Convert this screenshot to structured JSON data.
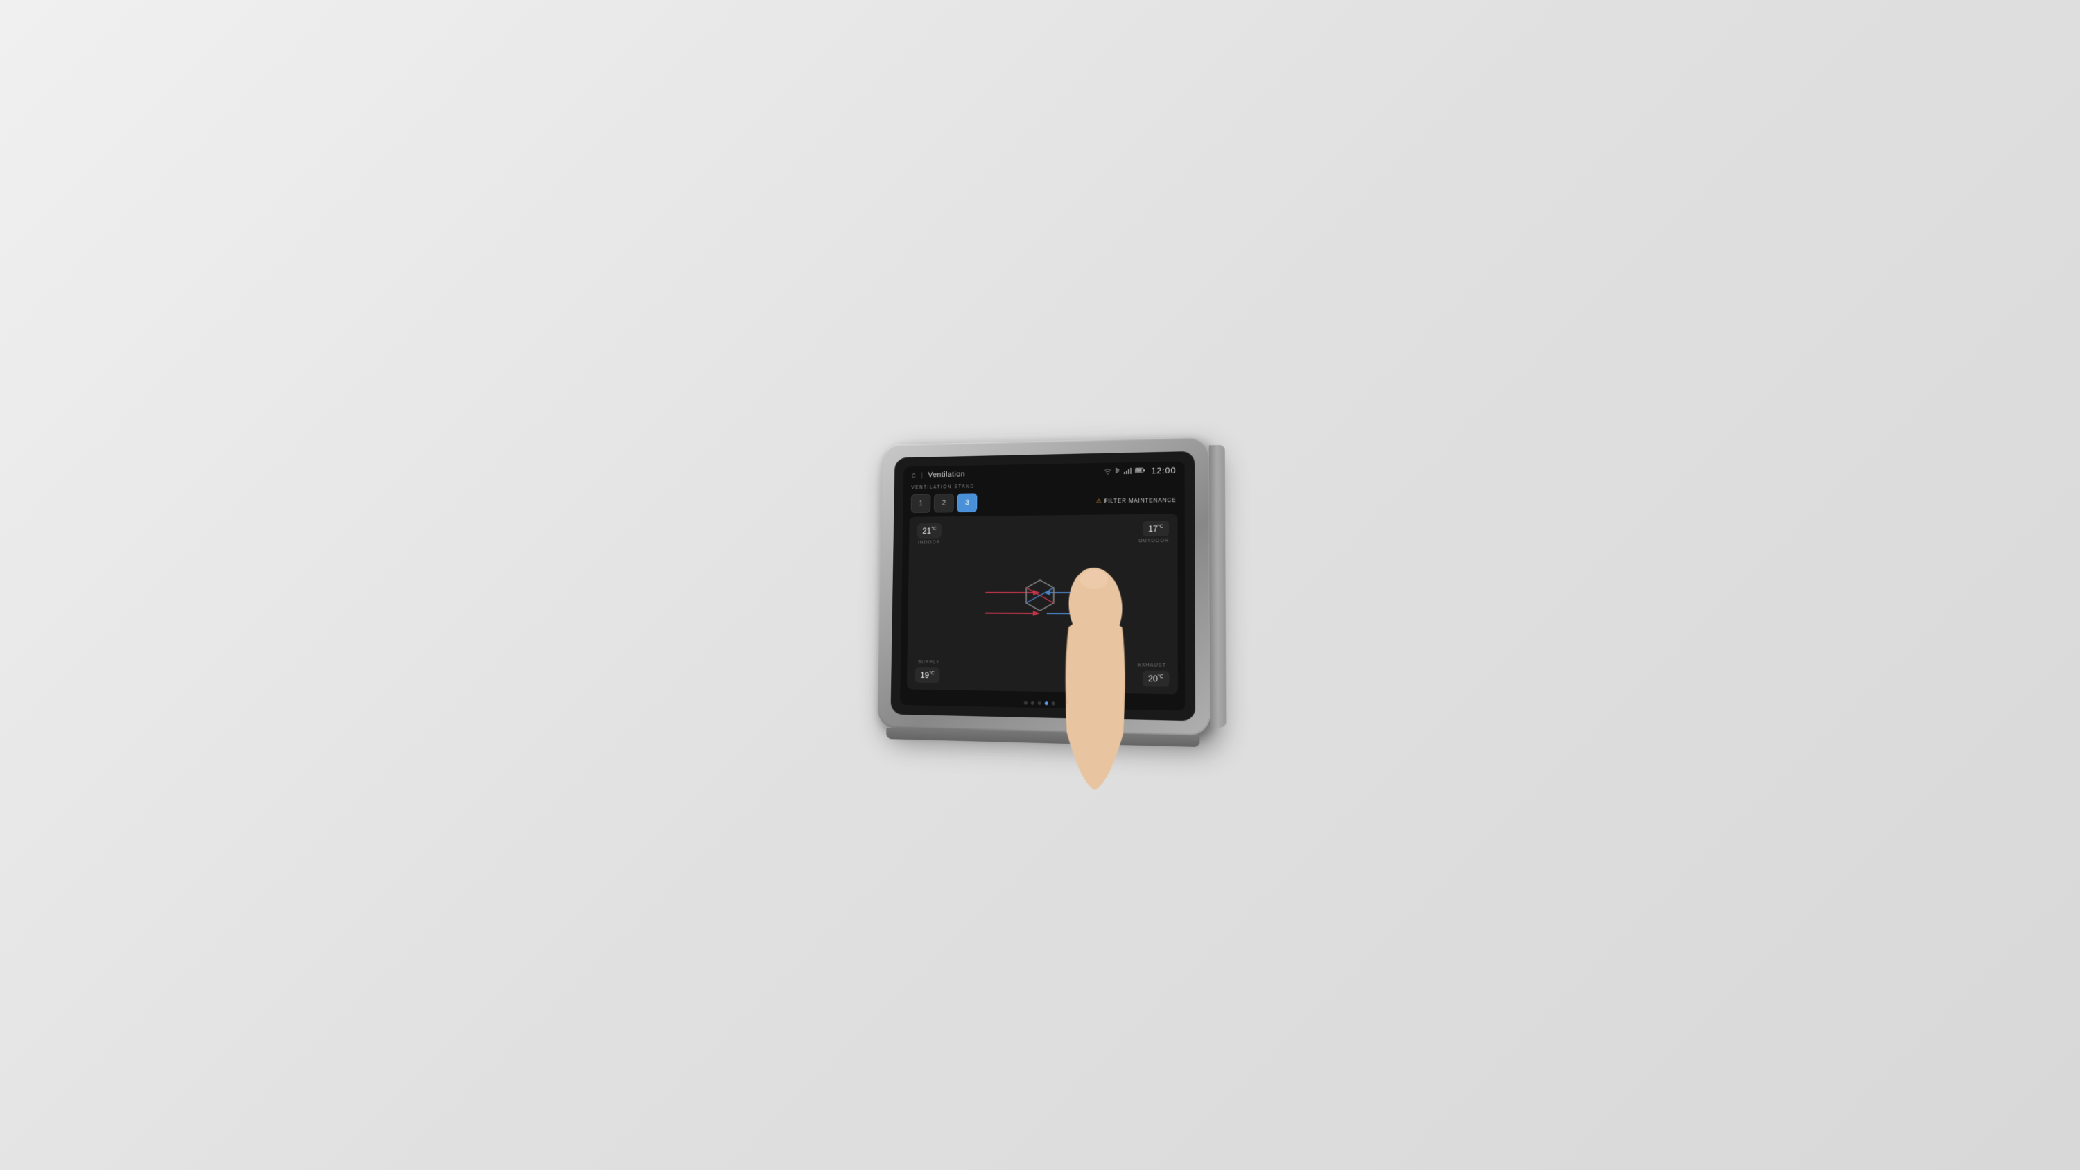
{
  "wall": {
    "background": "#e0e0e0"
  },
  "device": {
    "screen": {
      "status_bar": {
        "home_icon": "⌂",
        "separator": "|",
        "page_title": "Ventilation",
        "wifi_icon": "wifi",
        "bluetooth_icon": "bt",
        "signal_icon": "sig",
        "battery_icon": "bat",
        "time": "12:00"
      },
      "ventilation_stand": {
        "label": "VENTILATION STAND",
        "buttons": [
          {
            "value": "1",
            "active": false
          },
          {
            "value": "2",
            "active": false
          },
          {
            "value": "3",
            "active": true
          }
        ],
        "filter_maintenance": {
          "warning_icon": "⚠",
          "text": "FILTER MAINTENANCE"
        }
      },
      "main_card": {
        "indoor": {
          "temp": "21",
          "unit": "°C",
          "label": "INDOOR"
        },
        "outdoor": {
          "temp": "17",
          "unit": "°C",
          "label": "OUTDOOR"
        },
        "supply": {
          "temp": "19",
          "unit": "°C",
          "label": "SUPPLY"
        },
        "exhaust": {
          "temp": "20",
          "unit": "°C",
          "label": "EXHAUST"
        }
      },
      "page_dots": {
        "count": 5,
        "active_index": 3
      }
    }
  }
}
